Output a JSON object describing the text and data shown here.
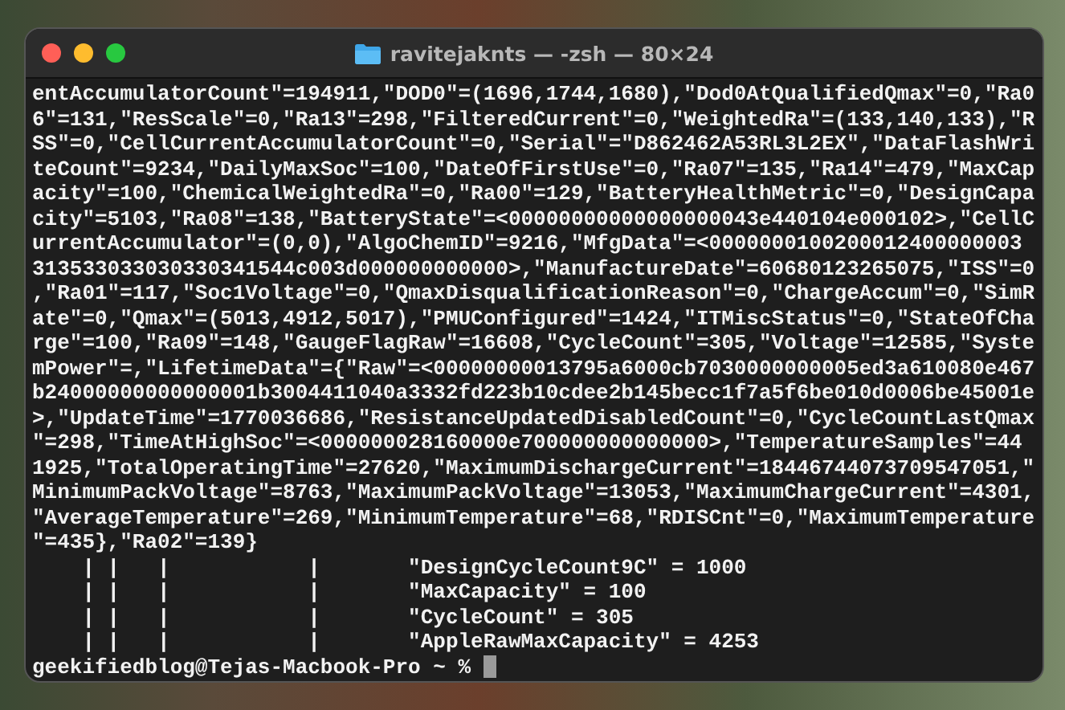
{
  "window": {
    "title": "ravitejaknts — -zsh — 80×24"
  },
  "output_lines": [
    "entAccumulatorCount\"=194911,\"DOD0\"=(1696,1744,1680),\"Dod0AtQualifiedQmax\"=0,\"Ra0",
    "6\"=131,\"ResScale\"=0,\"Ra13\"=298,\"FilteredCurrent\"=0,\"WeightedRa\"=(133,140,133),\"R",
    "SS\"=0,\"CellCurrentAccumulatorCount\"=0,\"Serial\"=\"D862462A53RL3L2EX\",\"DataFlashWri",
    "teCount\"=9234,\"DailyMaxSoc\"=100,\"DateOfFirstUse\"=0,\"Ra07\"=135,\"Ra14\"=479,\"MaxCap",
    "acity\"=100,\"ChemicalWeightedRa\"=0,\"Ra00\"=129,\"BatteryHealthMetric\"=0,\"DesignCapa",
    "city\"=5103,\"Ra08\"=138,\"BatteryState\"=<00000000000000000043e440104e000102>,\"CellC",
    "urrentAccumulator\"=(0,0),\"AlgoChemID\"=9216,\"MfgData\"=<0000000100200012400000003",
    "313533033030330341544c003d000000000000>,\"ManufactureDate\"=60680123265075,\"ISS\"=0",
    ",\"Ra01\"=117,\"Soc1Voltage\"=0,\"QmaxDisqualificationReason\"=0,\"ChargeAccum\"=0,\"SimR",
    "ate\"=0,\"Qmax\"=(5013,4912,5017),\"PMUConfigured\"=1424,\"ITMiscStatus\"=0,\"StateOfCha",
    "rge\"=100,\"Ra09\"=148,\"GaugeFlagRaw\"=16608,\"CycleCount\"=305,\"Voltage\"=12585,\"Syste",
    "mPower\"=,\"LifetimeData\"={\"Raw\"=<00000000013795a6000cb7030000000005ed3a610080e467",
    "b24000000000000001b3004411040a3332fd223b10cdee2b145becc1f7a5f6be010d0006be45001e",
    ">,\"UpdateTime\"=1770036686,\"ResistanceUpdatedDisabledCount\"=0,\"CycleCountLastQmax",
    "\"=298,\"TimeAtHighSoc\"=<000000028160000e700000000000000>,\"TemperatureSamples\"=44",
    "1925,\"TotalOperatingTime\"=27620,\"MaximumDischargeCurrent\"=18446744073709547051,\"",
    "MinimumPackVoltage\"=8763,\"MaximumPackVoltage\"=13053,\"MaximumChargeCurrent\"=4301,",
    "\"AverageTemperature\"=269,\"MinimumTemperature\"=68,\"RDISCnt\"=0,\"MaximumTemperature",
    "\"=435},\"Ra02\"=139}",
    "    | |   |           |       \"DesignCycleCount9C\" = 1000",
    "    | |   |           |       \"MaxCapacity\" = 100",
    "    | |   |           |       \"CycleCount\" = 305",
    "    | |   |           |       \"AppleRawMaxCapacity\" = 4253"
  ],
  "prompt": "geekifiedblog@Tejas-Macbook-Pro ~ %"
}
